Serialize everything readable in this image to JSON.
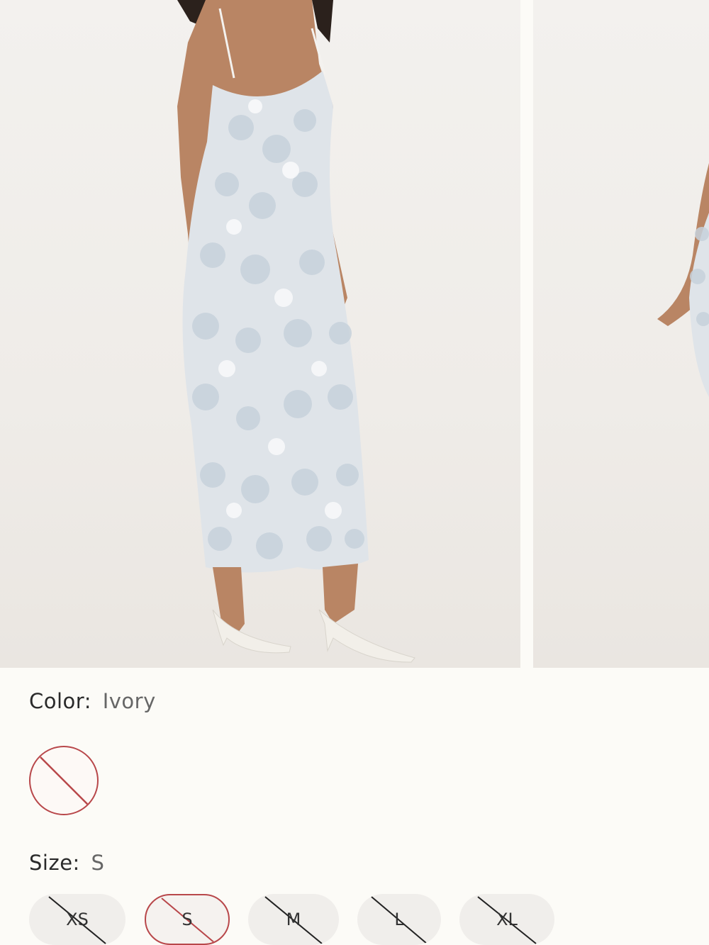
{
  "gallery": {
    "images": [
      {
        "alt": "Model wearing sequin slip dress"
      },
      {
        "alt": "Model wearing sequin slip dress, side view"
      }
    ]
  },
  "color": {
    "label": "Color:",
    "value": "Ivory",
    "swatches": [
      {
        "name": "Ivory",
        "available": false,
        "selected": true,
        "strike_color": "#b8474a"
      }
    ]
  },
  "size": {
    "label": "Size:",
    "value": "S",
    "options": [
      {
        "label": "XS",
        "available": false,
        "selected": false
      },
      {
        "label": "S",
        "available": false,
        "selected": true
      },
      {
        "label": "M",
        "available": false,
        "selected": false
      },
      {
        "label": "L",
        "available": false,
        "selected": false
      },
      {
        "label": "XL",
        "available": false,
        "selected": false
      }
    ]
  },
  "colors": {
    "background": "#fcfbf7",
    "pill": "#f0eeeb",
    "accent_unavailable": "#b8474a",
    "text": "#2a2a2a"
  }
}
